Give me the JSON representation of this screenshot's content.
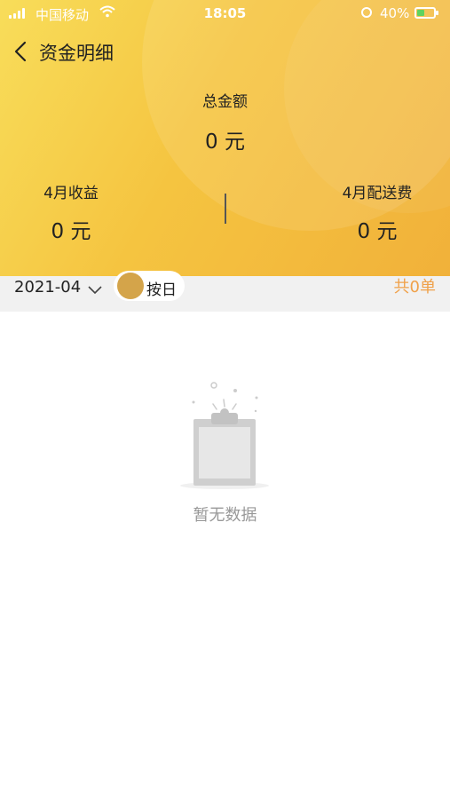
{
  "status_bar": {
    "carrier": "中国移动",
    "time": "18:05",
    "battery": "40%"
  },
  "nav": {
    "title": "资金明细"
  },
  "summary": {
    "total_label": "总金额",
    "total_value": "0 元",
    "income_label": "4月收益",
    "income_value": "0 元",
    "delivery_label": "4月配送费",
    "delivery_value": "0 元"
  },
  "filter": {
    "month": "2021-04",
    "toggle_label": "按日",
    "count": "共0单"
  },
  "empty": {
    "text": "暂无数据"
  },
  "colors": {
    "header_start": "#f8dd5a",
    "header_end": "#f1b13a",
    "accent": "#f0a14a",
    "toggle_knob": "#d4a44a"
  }
}
